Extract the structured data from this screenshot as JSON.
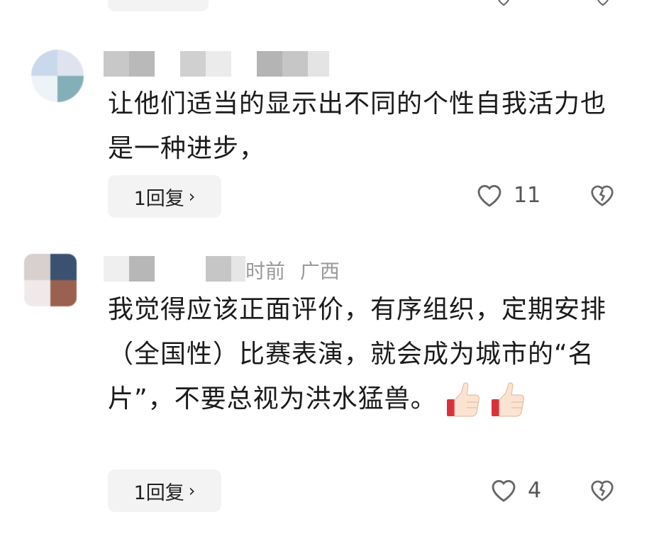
{
  "comments": [
    {
      "text": "让他们适当的显示出不同的个性自我活力也是一种进步，",
      "reply_label": "1回复",
      "like_count": "11"
    },
    {
      "meta_time": "时前",
      "meta_location": "广西",
      "text": "我觉得应该正面评价，有序组织，定期安排（全国性）比赛表演，就会成为城市的“名片”，不要总视为洪水猛兽。",
      "reply_label": "1回复",
      "like_count": "4"
    }
  ],
  "icons": {
    "like": "heart-icon",
    "dislike": "broken-heart-icon",
    "reply_chevron": "chevron-right-icon",
    "emoji": "thumbs-up-icon"
  },
  "colors": {
    "background": "#ffffff",
    "text": "#1b1b1b",
    "meta": "#9a9a9a",
    "pill": "#f3f3f3",
    "icon": "#555555"
  }
}
